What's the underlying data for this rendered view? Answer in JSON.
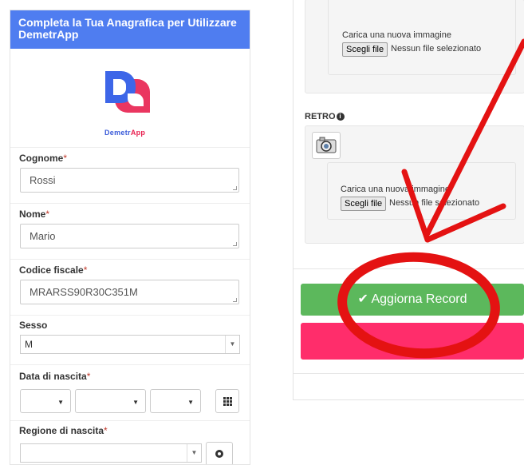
{
  "form": {
    "header_title": "Completa la Tua Anagrafica per Utilizzare DemetrApp",
    "logo_text_a": "Demetr",
    "logo_text_b": "App",
    "cognome_label": "Cognome",
    "cognome_value": "Rossi",
    "nome_label": "Nome",
    "nome_value": "Mario",
    "cf_label": "Codice fiscale",
    "cf_value": "MRARSS90R30C351M",
    "sesso_label": "Sesso",
    "sesso_value": "M",
    "data_label": "Data di nascita",
    "regione_label": "Regione di nascita",
    "required_mark": "*"
  },
  "upload": {
    "caption": "Carica una nuova immagine",
    "choose_btn": "Scegli file",
    "no_file": "Nessun file selezionato",
    "retro_label": "RETRO",
    "info_glyph": "i"
  },
  "actions": {
    "update_label": "Aggiorna Record",
    "check_glyph": "✔",
    "pink_label": ""
  },
  "icons": {
    "calendar": "grid-calendar-icon",
    "camera": "camera-icon",
    "check": "checkmark-icon"
  },
  "colors": {
    "header_blue": "#4f7df0",
    "success_green": "#5cb85c",
    "pink": "#ff2d6b",
    "annotation_red": "#e41212"
  }
}
